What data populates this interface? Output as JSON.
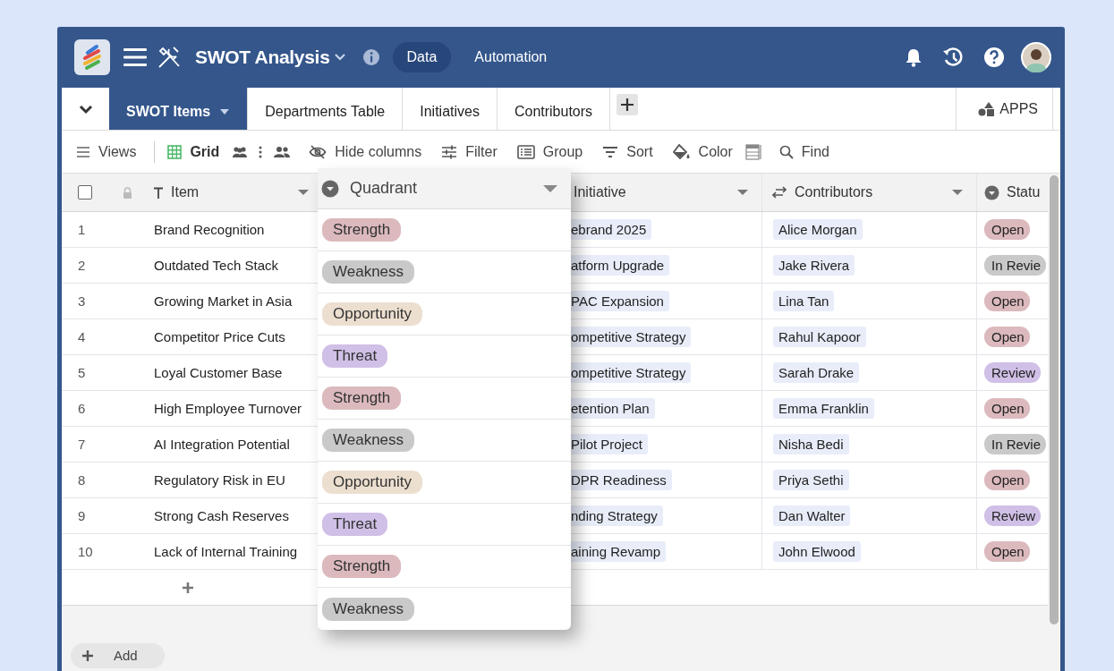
{
  "app": {
    "title": "SWOT Analysis",
    "nav": [
      {
        "label": "Data",
        "selected": true
      },
      {
        "label": "Automation",
        "selected": false
      }
    ]
  },
  "tabs": [
    {
      "label": "SWOT Items",
      "selected": true
    },
    {
      "label": "Departments Table",
      "selected": false
    },
    {
      "label": "Initiatives",
      "selected": false
    },
    {
      "label": "Contributors",
      "selected": false
    }
  ],
  "apps_button": "APPS",
  "toolbar": {
    "views": "Views",
    "grid": "Grid",
    "hide_columns": "Hide columns",
    "filter": "Filter",
    "group": "Group",
    "sort": "Sort",
    "paint": "Color",
    "find": "Find"
  },
  "select_all": {
    "checked": false
  },
  "columns": {
    "item": "Item",
    "quadrant": "Quadrant",
    "initiative": "Initiative",
    "contributors": "Contributors",
    "status": "Statu"
  },
  "rows": [
    {
      "number": "1",
      "item": "Brand Recognition",
      "initiative": "ebrand 2025",
      "contributor": "Alice Morgan",
      "status": {
        "label": "Open",
        "color": "#dbb9bd"
      }
    },
    {
      "number": "2",
      "item": "Outdated Tech Stack",
      "initiative": "atform Upgrade",
      "contributor": "Jake Rivera",
      "status": {
        "label": "In Revie",
        "color": "#c9c9c9"
      }
    },
    {
      "number": "3",
      "item": "Growing Market in Asia",
      "initiative": "PAC Expansion",
      "contributor": "Lina Tan",
      "status": {
        "label": "Open",
        "color": "#dbb9bd"
      }
    },
    {
      "number": "4",
      "item": "Competitor Price Cuts",
      "initiative": "ompetitive Strategy",
      "contributor": "Rahul Kapoor",
      "status": {
        "label": "Open",
        "color": "#dbb9bd"
      }
    },
    {
      "number": "5",
      "item": "Loyal Customer Base",
      "initiative": "ompetitive Strategy",
      "contributor": "Sarah Drake",
      "status": {
        "label": "Review",
        "color": "#d0bfe6"
      }
    },
    {
      "number": "6",
      "item": "High Employee Turnover",
      "initiative": "etention Plan",
      "contributor": "Emma Franklin",
      "status": {
        "label": "Open",
        "color": "#dbb9bd"
      }
    },
    {
      "number": "7",
      "item": "AI Integration Potential",
      "initiative": "Pilot Project",
      "contributor": "Nisha Bedi",
      "status": {
        "label": "In Revie",
        "color": "#c9c9c9"
      }
    },
    {
      "number": "8",
      "item": "Regulatory Risk in EU",
      "initiative": "DPR Readiness",
      "contributor": "Priya Sethi",
      "status": {
        "label": "Open",
        "color": "#dbb9bd"
      }
    },
    {
      "number": "9",
      "item": "Strong Cash Reserves",
      "initiative": "nding Strategy",
      "contributor": "Dan Walter",
      "status": {
        "label": "Review",
        "color": "#d0bfe6"
      }
    },
    {
      "number": "10",
      "item": "Lack of Internal Training",
      "initiative": "aining Revamp",
      "contributor": "John Elwood",
      "status": {
        "label": "Open",
        "color": "#dbb9bd"
      }
    }
  ],
  "quadrant_cells": [
    {
      "label": "Strength",
      "color": "#dbb9bd"
    },
    {
      "label": "Weakness",
      "color": "#c9c9c9"
    },
    {
      "label": "Opportunity",
      "color": "#ecdfcf"
    },
    {
      "label": "Threat",
      "color": "#d0bfe6"
    },
    {
      "label": "Strength",
      "color": "#dbb9bd"
    },
    {
      "label": "Weakness",
      "color": "#c9c9c9"
    },
    {
      "label": "Opportunity",
      "color": "#ecdfcf"
    },
    {
      "label": "Threat",
      "color": "#d0bfe6"
    },
    {
      "label": "Strength",
      "color": "#dbb9bd"
    },
    {
      "label": "Weakness",
      "color": "#c9c9c9"
    }
  ],
  "add_button": "Add"
}
